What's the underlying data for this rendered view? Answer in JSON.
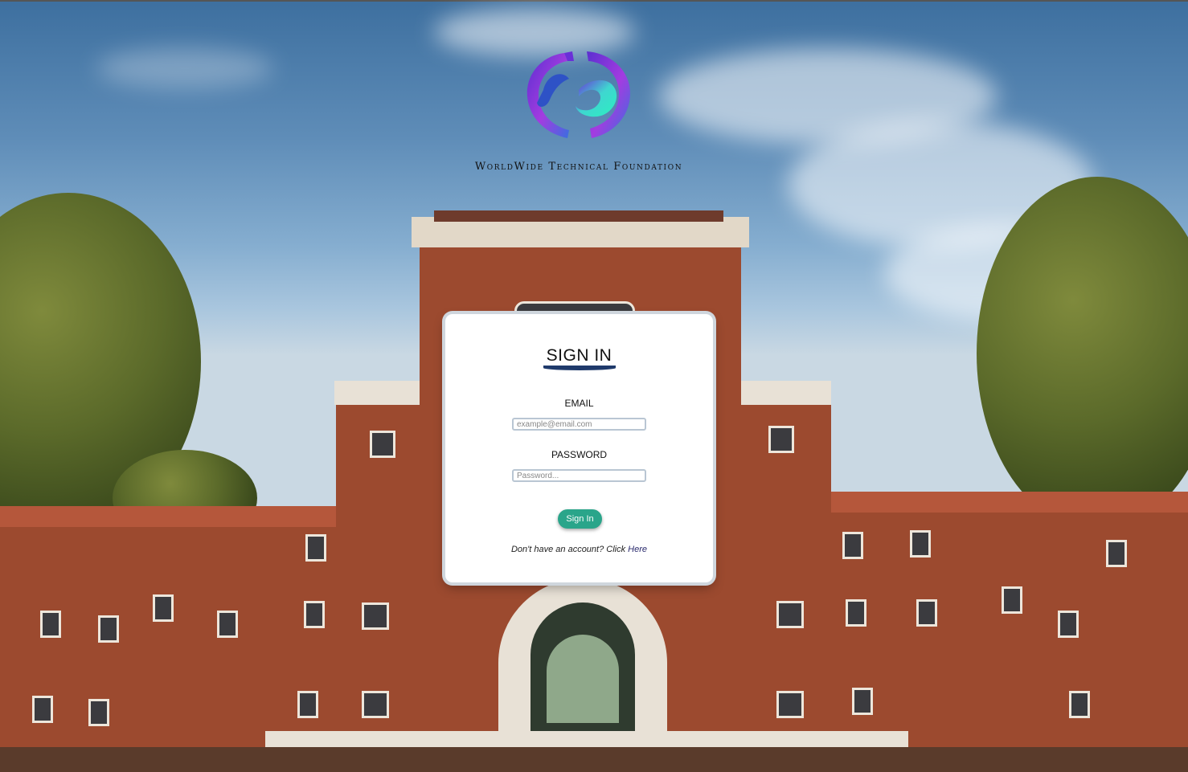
{
  "brand": {
    "logo_icon": "swirl-globe-logo-icon",
    "name": "WorldWide Technical Foundation",
    "colors": {
      "logo_purple": "#7a2fd6",
      "logo_teal": "#33e0c8"
    }
  },
  "background": {
    "description_icon": "campus-building-photo"
  },
  "signin": {
    "title": "SIGN IN",
    "email_label": "EMAIL",
    "email_placeholder": "example@email.com",
    "password_label": "PASSWORD",
    "password_placeholder": "Password...",
    "button_label": "Sign In",
    "signup_prefix": "Don't have an account? Click ",
    "signup_link": "Here"
  },
  "colors": {
    "accent": "#2aa58a",
    "title_underline": "#1f3a6b"
  }
}
